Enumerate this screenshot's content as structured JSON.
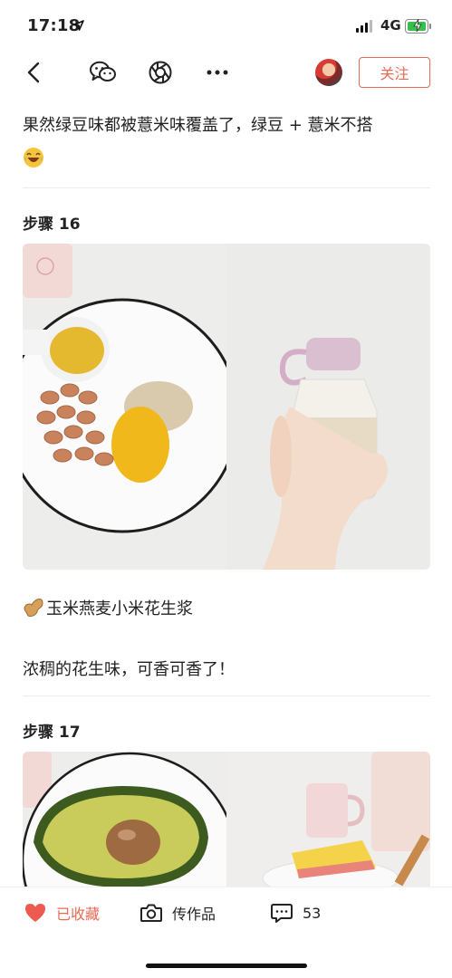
{
  "status_bar": {
    "time": "17:18",
    "network": "4G"
  },
  "nav": {
    "icons": [
      "back-chevron-icon",
      "wechat-icon",
      "moments-icon",
      "more-icon"
    ],
    "follow_label": "关注"
  },
  "article": {
    "intro_text": "果然绿豆味都被薏米味覆盖了，绿豆 + 薏米不搭",
    "steps": [
      {
        "title": "步骤 16",
        "caption_title": "玉米燕麦小米花生浆",
        "caption_body": "浓稠的花生味，可香可香了！"
      },
      {
        "title": "步骤 17"
      }
    ]
  },
  "bottom_bar": {
    "favorite_label": "已收藏",
    "upload_label": "传作品",
    "comment_count": "53"
  },
  "colors": {
    "accent": "#e86a55",
    "heart": "#ec5a50",
    "battery": "#35c04a"
  }
}
